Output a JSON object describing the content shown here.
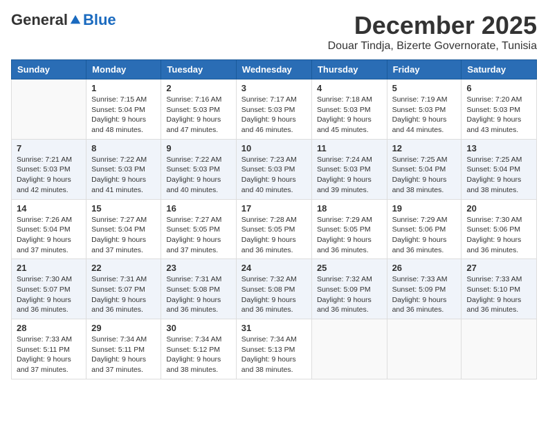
{
  "logo": {
    "general": "General",
    "blue": "Blue"
  },
  "title": {
    "month_year": "December 2025",
    "location": "Douar Tindja, Bizerte Governorate, Tunisia"
  },
  "headers": [
    "Sunday",
    "Monday",
    "Tuesday",
    "Wednesday",
    "Thursday",
    "Friday",
    "Saturday"
  ],
  "weeks": [
    [
      {
        "day": "",
        "info": ""
      },
      {
        "day": "1",
        "info": "Sunrise: 7:15 AM\nSunset: 5:04 PM\nDaylight: 9 hours\nand 48 minutes."
      },
      {
        "day": "2",
        "info": "Sunrise: 7:16 AM\nSunset: 5:03 PM\nDaylight: 9 hours\nand 47 minutes."
      },
      {
        "day": "3",
        "info": "Sunrise: 7:17 AM\nSunset: 5:03 PM\nDaylight: 9 hours\nand 46 minutes."
      },
      {
        "day": "4",
        "info": "Sunrise: 7:18 AM\nSunset: 5:03 PM\nDaylight: 9 hours\nand 45 minutes."
      },
      {
        "day": "5",
        "info": "Sunrise: 7:19 AM\nSunset: 5:03 PM\nDaylight: 9 hours\nand 44 minutes."
      },
      {
        "day": "6",
        "info": "Sunrise: 7:20 AM\nSunset: 5:03 PM\nDaylight: 9 hours\nand 43 minutes."
      }
    ],
    [
      {
        "day": "7",
        "info": "Sunrise: 7:21 AM\nSunset: 5:03 PM\nDaylight: 9 hours\nand 42 minutes."
      },
      {
        "day": "8",
        "info": "Sunrise: 7:22 AM\nSunset: 5:03 PM\nDaylight: 9 hours\nand 41 minutes."
      },
      {
        "day": "9",
        "info": "Sunrise: 7:22 AM\nSunset: 5:03 PM\nDaylight: 9 hours\nand 40 minutes."
      },
      {
        "day": "10",
        "info": "Sunrise: 7:23 AM\nSunset: 5:03 PM\nDaylight: 9 hours\nand 40 minutes."
      },
      {
        "day": "11",
        "info": "Sunrise: 7:24 AM\nSunset: 5:03 PM\nDaylight: 9 hours\nand 39 minutes."
      },
      {
        "day": "12",
        "info": "Sunrise: 7:25 AM\nSunset: 5:04 PM\nDaylight: 9 hours\nand 38 minutes."
      },
      {
        "day": "13",
        "info": "Sunrise: 7:25 AM\nSunset: 5:04 PM\nDaylight: 9 hours\nand 38 minutes."
      }
    ],
    [
      {
        "day": "14",
        "info": "Sunrise: 7:26 AM\nSunset: 5:04 PM\nDaylight: 9 hours\nand 37 minutes."
      },
      {
        "day": "15",
        "info": "Sunrise: 7:27 AM\nSunset: 5:04 PM\nDaylight: 9 hours\nand 37 minutes."
      },
      {
        "day": "16",
        "info": "Sunrise: 7:27 AM\nSunset: 5:05 PM\nDaylight: 9 hours\nand 37 minutes."
      },
      {
        "day": "17",
        "info": "Sunrise: 7:28 AM\nSunset: 5:05 PM\nDaylight: 9 hours\nand 36 minutes."
      },
      {
        "day": "18",
        "info": "Sunrise: 7:29 AM\nSunset: 5:05 PM\nDaylight: 9 hours\nand 36 minutes."
      },
      {
        "day": "19",
        "info": "Sunrise: 7:29 AM\nSunset: 5:06 PM\nDaylight: 9 hours\nand 36 minutes."
      },
      {
        "day": "20",
        "info": "Sunrise: 7:30 AM\nSunset: 5:06 PM\nDaylight: 9 hours\nand 36 minutes."
      }
    ],
    [
      {
        "day": "21",
        "info": "Sunrise: 7:30 AM\nSunset: 5:07 PM\nDaylight: 9 hours\nand 36 minutes."
      },
      {
        "day": "22",
        "info": "Sunrise: 7:31 AM\nSunset: 5:07 PM\nDaylight: 9 hours\nand 36 minutes."
      },
      {
        "day": "23",
        "info": "Sunrise: 7:31 AM\nSunset: 5:08 PM\nDaylight: 9 hours\nand 36 minutes."
      },
      {
        "day": "24",
        "info": "Sunrise: 7:32 AM\nSunset: 5:08 PM\nDaylight: 9 hours\nand 36 minutes."
      },
      {
        "day": "25",
        "info": "Sunrise: 7:32 AM\nSunset: 5:09 PM\nDaylight: 9 hours\nand 36 minutes."
      },
      {
        "day": "26",
        "info": "Sunrise: 7:33 AM\nSunset: 5:09 PM\nDaylight: 9 hours\nand 36 minutes."
      },
      {
        "day": "27",
        "info": "Sunrise: 7:33 AM\nSunset: 5:10 PM\nDaylight: 9 hours\nand 36 minutes."
      }
    ],
    [
      {
        "day": "28",
        "info": "Sunrise: 7:33 AM\nSunset: 5:11 PM\nDaylight: 9 hours\nand 37 minutes."
      },
      {
        "day": "29",
        "info": "Sunrise: 7:34 AM\nSunset: 5:11 PM\nDaylight: 9 hours\nand 37 minutes."
      },
      {
        "day": "30",
        "info": "Sunrise: 7:34 AM\nSunset: 5:12 PM\nDaylight: 9 hours\nand 38 minutes."
      },
      {
        "day": "31",
        "info": "Sunrise: 7:34 AM\nSunset: 5:13 PM\nDaylight: 9 hours\nand 38 minutes."
      },
      {
        "day": "",
        "info": ""
      },
      {
        "day": "",
        "info": ""
      },
      {
        "day": "",
        "info": ""
      }
    ]
  ]
}
